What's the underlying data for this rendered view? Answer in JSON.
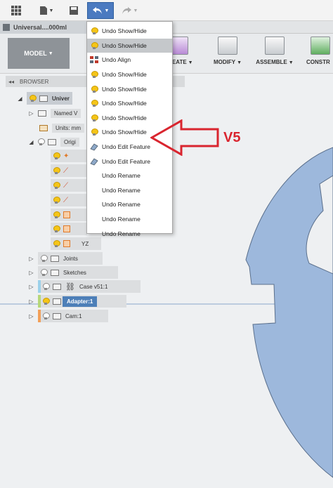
{
  "toolbar": {
    "grid_icon": "grid-icon",
    "file_icon": "file-icon",
    "save_icon": "save-icon",
    "undo_icon": "undo-icon",
    "redo_icon": "redo-icon"
  },
  "doc_tab": {
    "title": "Universal....000ml"
  },
  "ribbon": {
    "workspace": "MODEL",
    "groups": [
      {
        "label": "CREATE"
      },
      {
        "label": "MODIFY"
      },
      {
        "label": "ASSEMBLE"
      },
      {
        "label": "CONSTR"
      }
    ]
  },
  "browser": {
    "header": "BROWSER",
    "root": "Univer",
    "nodes": {
      "named_views": "Named V",
      "units": "Units: mm",
      "origin": "Origi",
      "yz": "YZ",
      "joints": "Joints",
      "sketches": "Sketches",
      "case": "Case v51:1",
      "adapter": "Adapter:1",
      "cam": "Cam:1"
    }
  },
  "undo_menu": {
    "items": [
      {
        "label": "Undo Show/Hide",
        "icon": "bulb",
        "highlighted": false
      },
      {
        "label": "Undo Show/Hide",
        "icon": "bulb",
        "highlighted": true
      },
      {
        "label": "Undo Align",
        "icon": "align",
        "highlighted": false
      },
      {
        "label": "Undo Show/Hide",
        "icon": "bulb",
        "highlighted": false
      },
      {
        "label": "Undo Show/Hide",
        "icon": "bulb",
        "highlighted": false
      },
      {
        "label": "Undo Show/Hide",
        "icon": "bulb",
        "highlighted": false
      },
      {
        "label": "Undo Show/Hide",
        "icon": "bulb",
        "highlighted": false
      },
      {
        "label": "Undo Show/Hide",
        "icon": "bulb",
        "highlighted": false
      },
      {
        "label": "Undo Edit Feature",
        "icon": "feature",
        "highlighted": false
      },
      {
        "label": "Undo Edit Feature",
        "icon": "feature",
        "highlighted": false
      },
      {
        "label": "Undo Rename",
        "icon": "none",
        "highlighted": false
      },
      {
        "label": "Undo Rename",
        "icon": "none",
        "highlighted": false
      },
      {
        "label": "Undo Rename",
        "icon": "none",
        "highlighted": false
      },
      {
        "label": "Undo Rename",
        "icon": "none",
        "highlighted": false
      },
      {
        "label": "Undo Rename",
        "icon": "none",
        "highlighted": false
      }
    ]
  },
  "annotation": {
    "text": "V5",
    "color": "#d9252f"
  },
  "colors": {
    "accent": "#4b7ac0",
    "part_fill": "#9db8dc",
    "selected_node": "#4d7fb8"
  }
}
